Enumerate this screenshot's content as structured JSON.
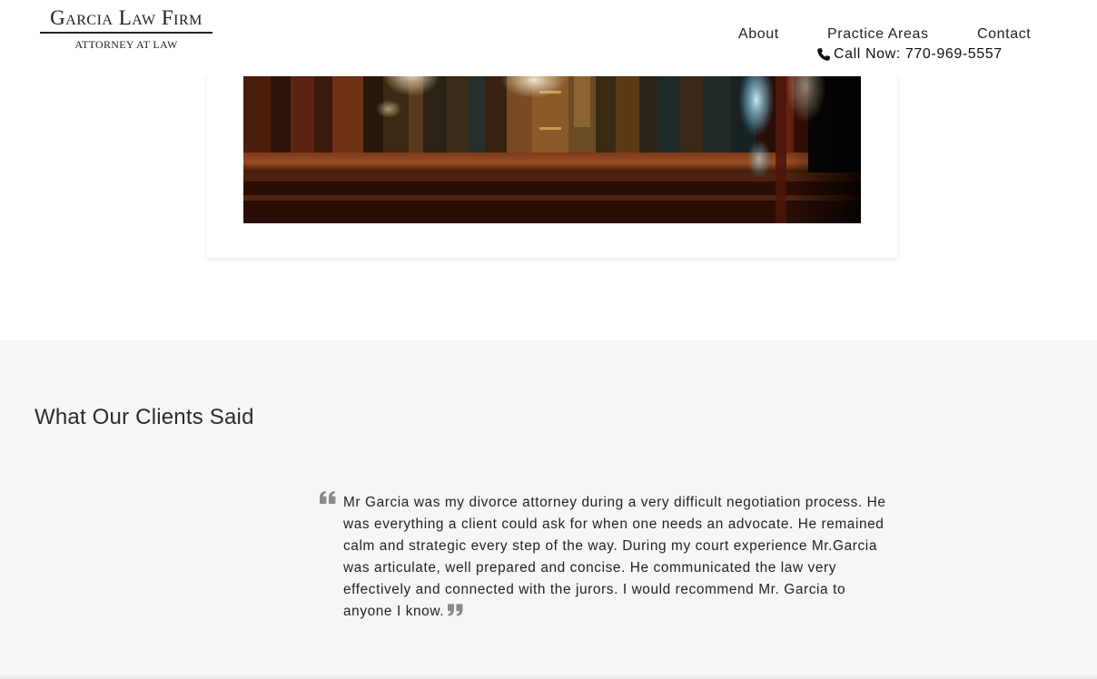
{
  "header": {
    "logo_title": "Garcia Law Firm",
    "logo_subtitle": "ATTORNEY AT LAW",
    "nav": {
      "about": "About",
      "practice_areas": "Practice Areas",
      "contact": "Contact"
    },
    "call_now": "Call Now: 770-969-5557",
    "phone_icon": "phone-icon"
  },
  "hero_image": {
    "description_icon": "bookshelf-photo"
  },
  "testimonials": {
    "title": "What Our Clients Said",
    "quote": "Mr Garcia was my divorce attorney during a very difficult negotiation process. He was everything a client could ask for when one needs an advocate. He remained calm and strategic every step of the way. During my court experience Mr.Garcia was articulate, well prepared and concise. He communicated the law very effectively and connected with the jurors. I would recommend Mr. Garcia to anyone I know.",
    "quote_icon_color": "#8a8a8a"
  },
  "colors": {
    "section_bg": "#f6f6f6",
    "text": "#222222"
  }
}
